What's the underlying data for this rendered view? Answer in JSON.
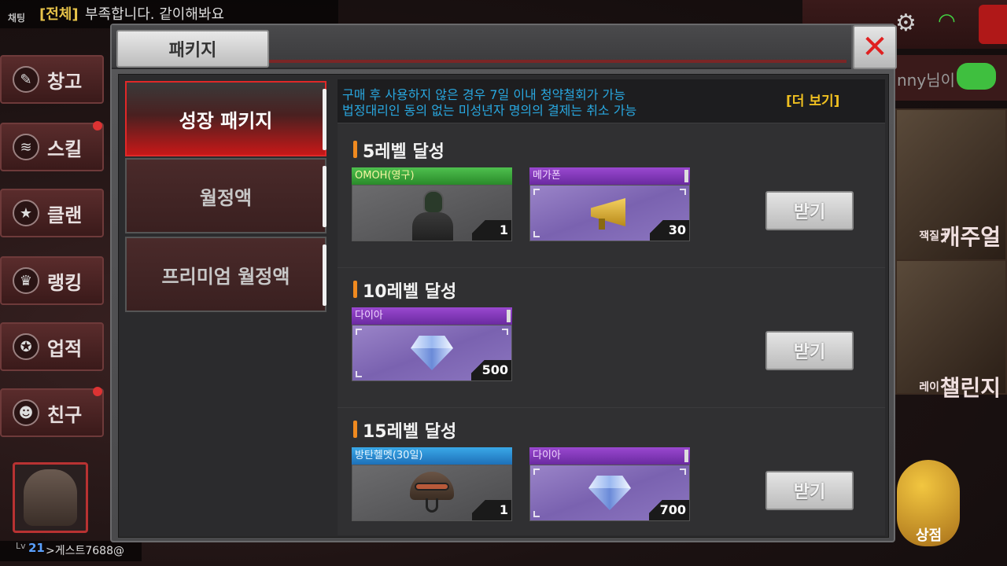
{
  "chat": {
    "tag": "채팅",
    "channel": "[전체]",
    "message": "부족합니다. 같이해봐요"
  },
  "left_menu": [
    {
      "label": "창고",
      "icon": "warehouse-icon",
      "glyph": "✎",
      "dot": false
    },
    {
      "label": "스킬",
      "icon": "skill-icon",
      "glyph": "≋",
      "dot": true
    },
    {
      "label": "클랜",
      "icon": "clan-icon",
      "glyph": "★",
      "dot": false
    },
    {
      "label": "랭킹",
      "icon": "ranking-icon",
      "glyph": "♛",
      "dot": false
    },
    {
      "label": "업적",
      "icon": "achievement-icon",
      "glyph": "✪",
      "dot": false
    },
    {
      "label": "친구",
      "icon": "friends-icon",
      "glyph": "☻",
      "dot": true
    }
  ],
  "right_side": {
    "username": "nny님이",
    "card1": "캐주얼",
    "card1_prefix": "잭질 |",
    "card2": "챌린지",
    "card2_prefix": "레이 |",
    "shop": "상점"
  },
  "player": {
    "lv_label": "Lv",
    "level": "21",
    "name": ">게스트7688@"
  },
  "modal": {
    "title": "패키지",
    "close_glyph": "✕",
    "tabs": [
      {
        "label": "성장 패키지",
        "active": true
      },
      {
        "label": "월정액",
        "active": false
      },
      {
        "label": "프리미엄 월정액",
        "active": false
      }
    ],
    "notice": {
      "line1": "구매 후 사용하지 않은 경우 7일 이내 청약철회가 가능",
      "line2": "법정대리인 동의 없는 미성년자 명의의 결제는 취소 가능",
      "more": "[더 보기]"
    },
    "levels": [
      {
        "title": "5레벨 달성",
        "claim": "받기",
        "rewards": [
          {
            "name": "OMOH(영구)",
            "color": "green",
            "qty": "1",
            "icon": "soldier-icon"
          },
          {
            "name": "메가폰",
            "color": "purple",
            "qty": "30",
            "icon": "megaphone-icon"
          }
        ]
      },
      {
        "title": "10레벨 달성",
        "claim": "받기",
        "rewards": [
          {
            "name": "다이아",
            "color": "purple",
            "qty": "500",
            "icon": "diamond-icon"
          }
        ]
      },
      {
        "title": "15레벨 달성",
        "claim": "받기",
        "rewards": [
          {
            "name": "방탄헬멧(30일)",
            "color": "blue",
            "qty": "1",
            "icon": "helmet-icon"
          },
          {
            "name": "다이아",
            "color": "purple",
            "qty": "700",
            "icon": "diamond-icon"
          }
        ]
      }
    ]
  },
  "colors": {
    "accent_red": "#c81818",
    "notice_blue": "#29a8e0",
    "more_yellow": "#f0c020",
    "level_bar": "#f08a20"
  }
}
